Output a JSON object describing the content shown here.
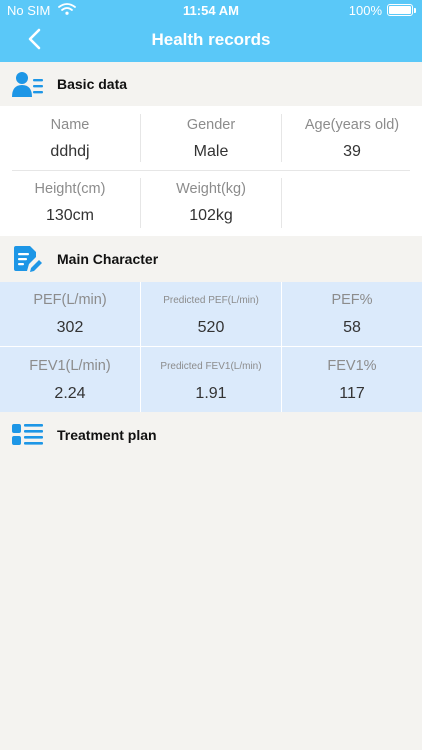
{
  "status": {
    "carrier": "No SIM",
    "time": "11:54 AM",
    "battery": "100%"
  },
  "header": {
    "title": "Health records"
  },
  "basic": {
    "title": "Basic data",
    "fields": [
      {
        "label": "Name",
        "value": "ddhdj"
      },
      {
        "label": "Gender",
        "value": "Male"
      },
      {
        "label": "Age(years old)",
        "value": "39"
      },
      {
        "label": "Height(cm)",
        "value": "130cm"
      },
      {
        "label": "Weight(kg)",
        "value": "102kg"
      }
    ]
  },
  "character": {
    "title": "Main Character",
    "fields": [
      {
        "label": "PEF(L/min)",
        "value": "302"
      },
      {
        "label": "Predicted PEF(L/min)",
        "value": "520"
      },
      {
        "label": "PEF%",
        "value": "58"
      },
      {
        "label": "FEV1(L/min)",
        "value": "2.24"
      },
      {
        "label": "Predicted FEV1(L/min)",
        "value": "1.91"
      },
      {
        "label": "FEV1%",
        "value": "117"
      }
    ]
  },
  "treatment": {
    "title": "Treatment plan"
  },
  "colors": {
    "header": "#5ac8f8",
    "accent": "#1d96e6",
    "tint": "#dbeafb",
    "background": "#f4f3f0"
  },
  "icons": [
    "back-chevron-icon",
    "wifi-icon",
    "battery-icon",
    "user-list-icon",
    "edit-document-icon",
    "list-icon"
  ]
}
